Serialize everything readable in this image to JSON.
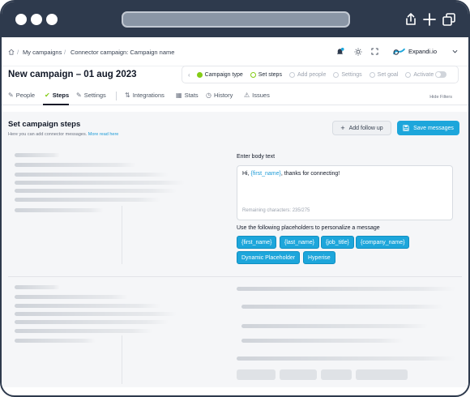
{
  "breadcrumb": {
    "items": [
      "My campaigns",
      "Connector campaign: Campaign name"
    ]
  },
  "header": {
    "account_name": "Expandi.io"
  },
  "campaign": {
    "title": "New campaign – 01 aug 2023"
  },
  "stepper": {
    "steps": [
      {
        "label": "Campaign type",
        "state": "done"
      },
      {
        "label": "Set steps",
        "state": "active"
      },
      {
        "label": "Add people",
        "state": "pending"
      },
      {
        "label": "Settings",
        "state": "pending"
      },
      {
        "label": "Set goal",
        "state": "pending"
      },
      {
        "label": "Activate",
        "state": "pending"
      }
    ]
  },
  "tabs": {
    "items": [
      "People",
      "Steps",
      "Settings",
      "Integrations",
      "Stats",
      "History",
      "Issues"
    ],
    "active": "Steps",
    "hide_filters": "Hide Filters"
  },
  "section": {
    "title": "Set campaign steps",
    "subtitle": "Here you can add connector messages.",
    "read_more": "More read here",
    "add_follow_up": "Add follow up",
    "save_messages": "Save messages"
  },
  "editor": {
    "body_label": "Enter body text",
    "text_prefix": "Hi, ",
    "text_placeholder": "{first_name}",
    "text_suffix": ", thanks for connecting!",
    "remaining": "Remaining characters: 235/275",
    "placeholders_label": "Use the following placeholders to personalize a message",
    "placeholders": [
      "{first_name}",
      "{last_name}",
      "{job_title}",
      "{company_name}",
      "Dynamic Placeholder",
      "Hyperise"
    ]
  },
  "colors": {
    "chrome": "#2e3a4d",
    "accent": "#1da6db",
    "success": "#84cc16"
  }
}
